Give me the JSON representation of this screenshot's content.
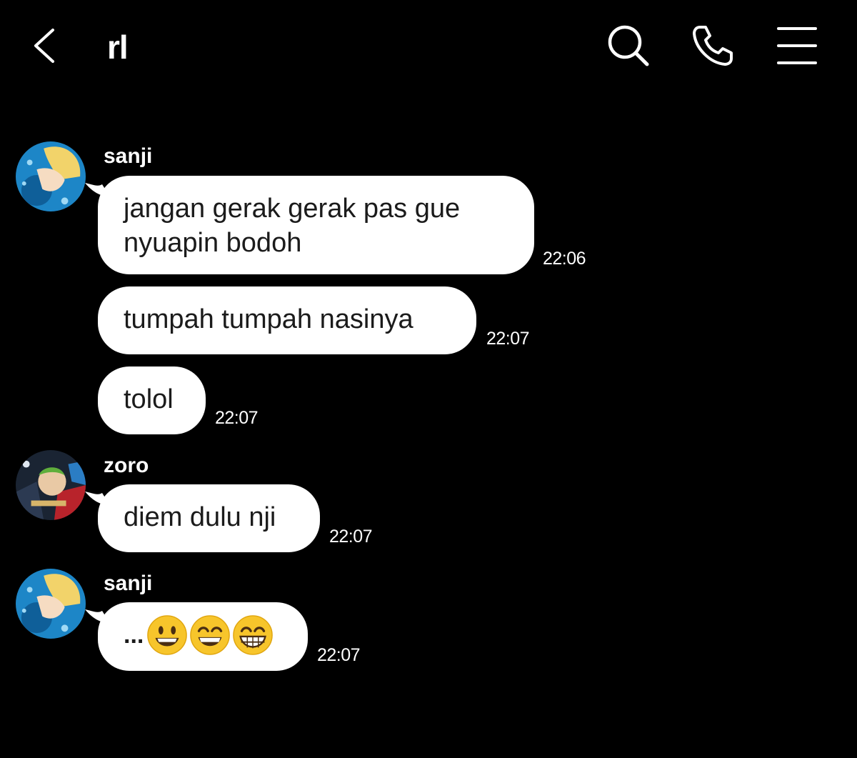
{
  "header": {
    "title": "rl",
    "icons": {
      "back": "chevron-left-icon",
      "search": "search-icon",
      "call": "phone-icon",
      "menu": "menu-icon"
    }
  },
  "messages": [
    {
      "sender": "sanji",
      "lines": [
        "jangan gerak gerak pas gue",
        "nyuapin bodoh"
      ],
      "time": "22:06"
    },
    {
      "sender": "",
      "lines": [
        "tumpah tumpah nasinya"
      ],
      "time": "22:07"
    },
    {
      "sender": "",
      "lines": [
        "tolol"
      ],
      "time": "22:07"
    },
    {
      "sender": "zoro",
      "lines": [
        "diem dulu nji"
      ],
      "time": "22:07"
    },
    {
      "sender": "sanji",
      "text_prefix": "...",
      "emojis": [
        "grinning-face",
        "grinning-face-with-smiling-eyes",
        "beaming-face"
      ],
      "time": "22:07"
    }
  ],
  "colors": {
    "background": "#000000",
    "bubble": "#ffffff",
    "bubble_text": "#1b1b1b",
    "meta_text": "#ffffff"
  }
}
